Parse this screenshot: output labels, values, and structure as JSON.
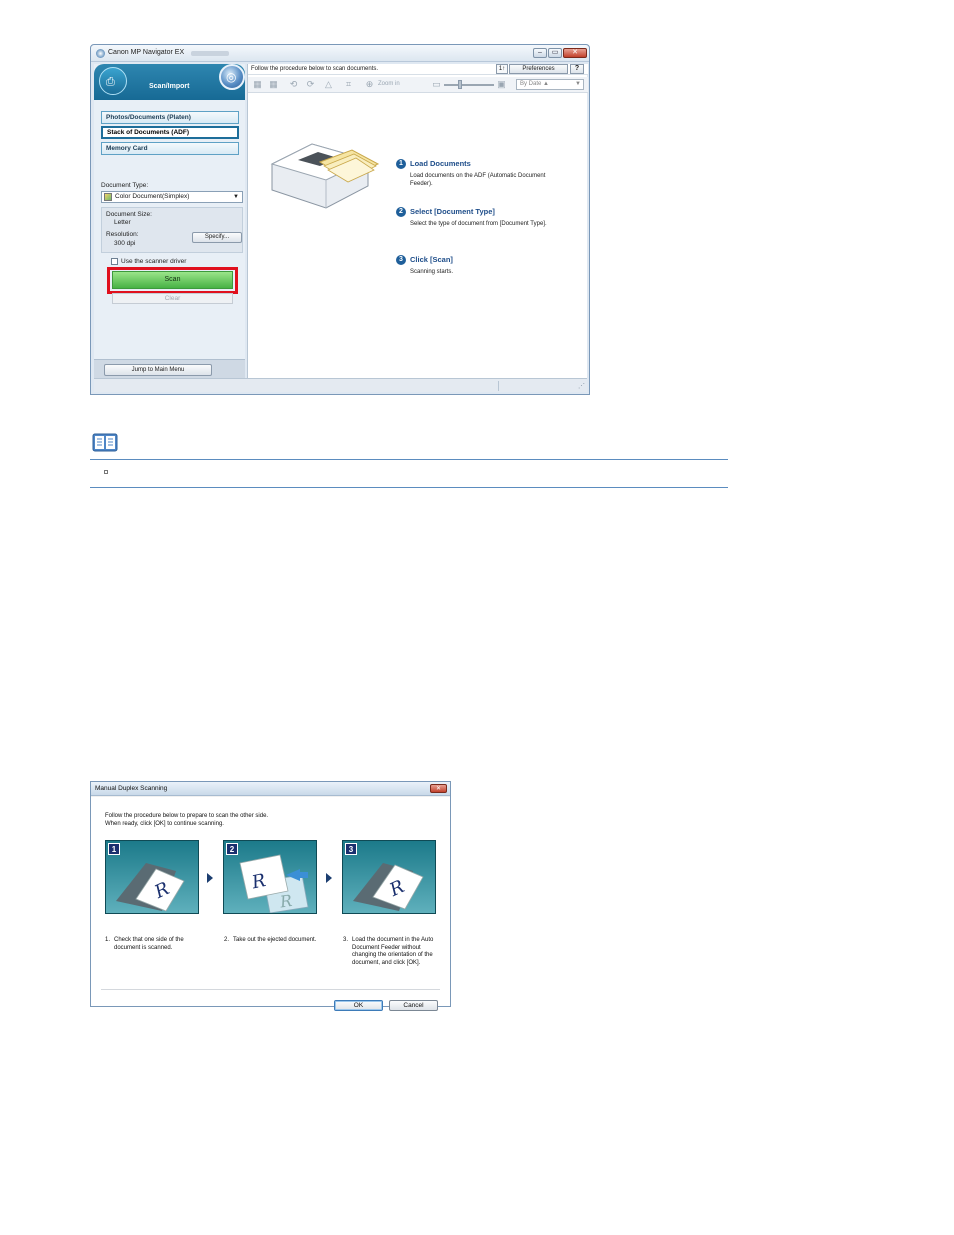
{
  "main_window": {
    "title": "Canon MP Navigator EX",
    "controls": {
      "minimize": "–",
      "maximize": "▭",
      "close": "✕"
    },
    "mode_label": "Scan/Import",
    "sources": [
      {
        "label": "Photos/Documents (Platen)",
        "selected": false
      },
      {
        "label": "Stack of Documents (ADF)",
        "selected": true
      },
      {
        "label": "Memory Card",
        "selected": false
      }
    ],
    "document_type_label": "Document Type:",
    "document_type_value": "Color Document(Simplex)",
    "document_size_label": "Document Size:",
    "document_size_value": "Letter",
    "resolution_label": "Resolution:",
    "resolution_value": "300 dpi",
    "specify_button": "Specify...",
    "scanner_driver_checkbox": {
      "label": "Use the scanner driver",
      "checked": false
    },
    "scan_button": "Scan",
    "clear_button": "Clear",
    "jump_button": "Jump to Main Menu",
    "info_text": "Follow the procedure below to scan documents.",
    "sort_button": "1↑",
    "preferences_button": "Preferences",
    "help_button": "?",
    "zoom_label": "Zoom in",
    "sort_select": "By Date",
    "steps": [
      {
        "number": "1",
        "title": "Load Documents",
        "desc": "Load documents on the ADF (Automatic Document Feeder)."
      },
      {
        "number": "2",
        "title": "Select [Document Type]",
        "desc": "Select the type of document from [Document Type]."
      },
      {
        "number": "3",
        "title": "Click [Scan]",
        "desc": "Scanning starts."
      }
    ],
    "highlight_color": "#e0101d"
  },
  "note": {
    "icon": "note-book-icon"
  },
  "dialog": {
    "title": "Manual Duplex Scanning",
    "instruction_line1": "Follow the procedure below to prepare to scan the other side.",
    "instruction_line2": "When ready, click [OK] to continue scanning.",
    "panels": [
      {
        "number": "1",
        "caption_num": "1.",
        "caption": "Check that one side of the document is scanned."
      },
      {
        "number": "2",
        "caption_num": "2.",
        "caption": "Take out the ejected document."
      },
      {
        "number": "3",
        "caption_num": "3.",
        "caption": "Load the document in the Auto Document Feeder without changing the orientation of the document, and click [OK]."
      }
    ],
    "ok_button": "OK",
    "cancel_button": "Cancel"
  }
}
